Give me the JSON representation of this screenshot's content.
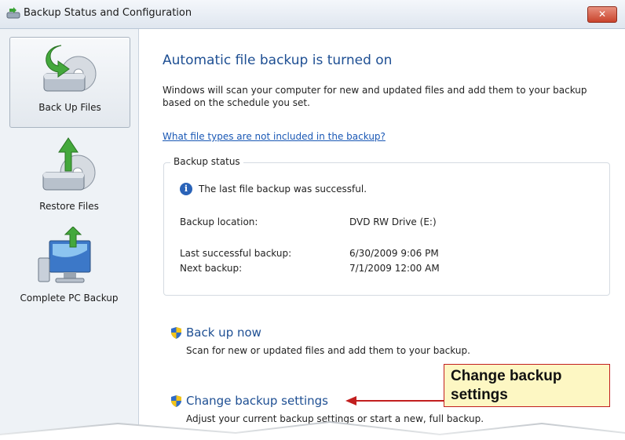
{
  "window": {
    "title": "Backup Status and Configuration",
    "close_glyph": "✕"
  },
  "sidebar": {
    "items": [
      {
        "label": "Back Up Files",
        "icon": "backup-drive-icon",
        "active": true
      },
      {
        "label": "Restore Files",
        "icon": "restore-drive-icon",
        "active": false
      },
      {
        "label": "Complete PC Backup",
        "icon": "pc-backup-icon",
        "active": false
      }
    ]
  },
  "main": {
    "heading": "Automatic file backup is turned on",
    "description": "Windows will scan your computer for new and updated files and add them to your backup based on the schedule you set.",
    "link": "What file types are not included in the backup?",
    "status": {
      "group_title": "Backup status",
      "message": "The last file backup was successful.",
      "rows": [
        {
          "label": "Backup location:",
          "value": "DVD RW Drive (E:)"
        },
        {
          "label": "Last successful backup:",
          "value": "6/30/2009 9:06 PM"
        },
        {
          "label": "Next backup:",
          "value": "7/1/2009 12:00 AM"
        }
      ]
    },
    "actions": [
      {
        "title": "Back up now",
        "description": "Scan for new or updated files and add them to your backup."
      },
      {
        "title": "Change backup settings",
        "description": "Adjust your current backup settings or start a new, full backup."
      }
    ]
  },
  "callout": {
    "line1": "Change backup",
    "line2": "settings"
  },
  "colors": {
    "heading": "#1e4f93",
    "link": "#1a58b5",
    "callout_bg": "#fdf7c3",
    "callout_border": "#c21f1f"
  }
}
